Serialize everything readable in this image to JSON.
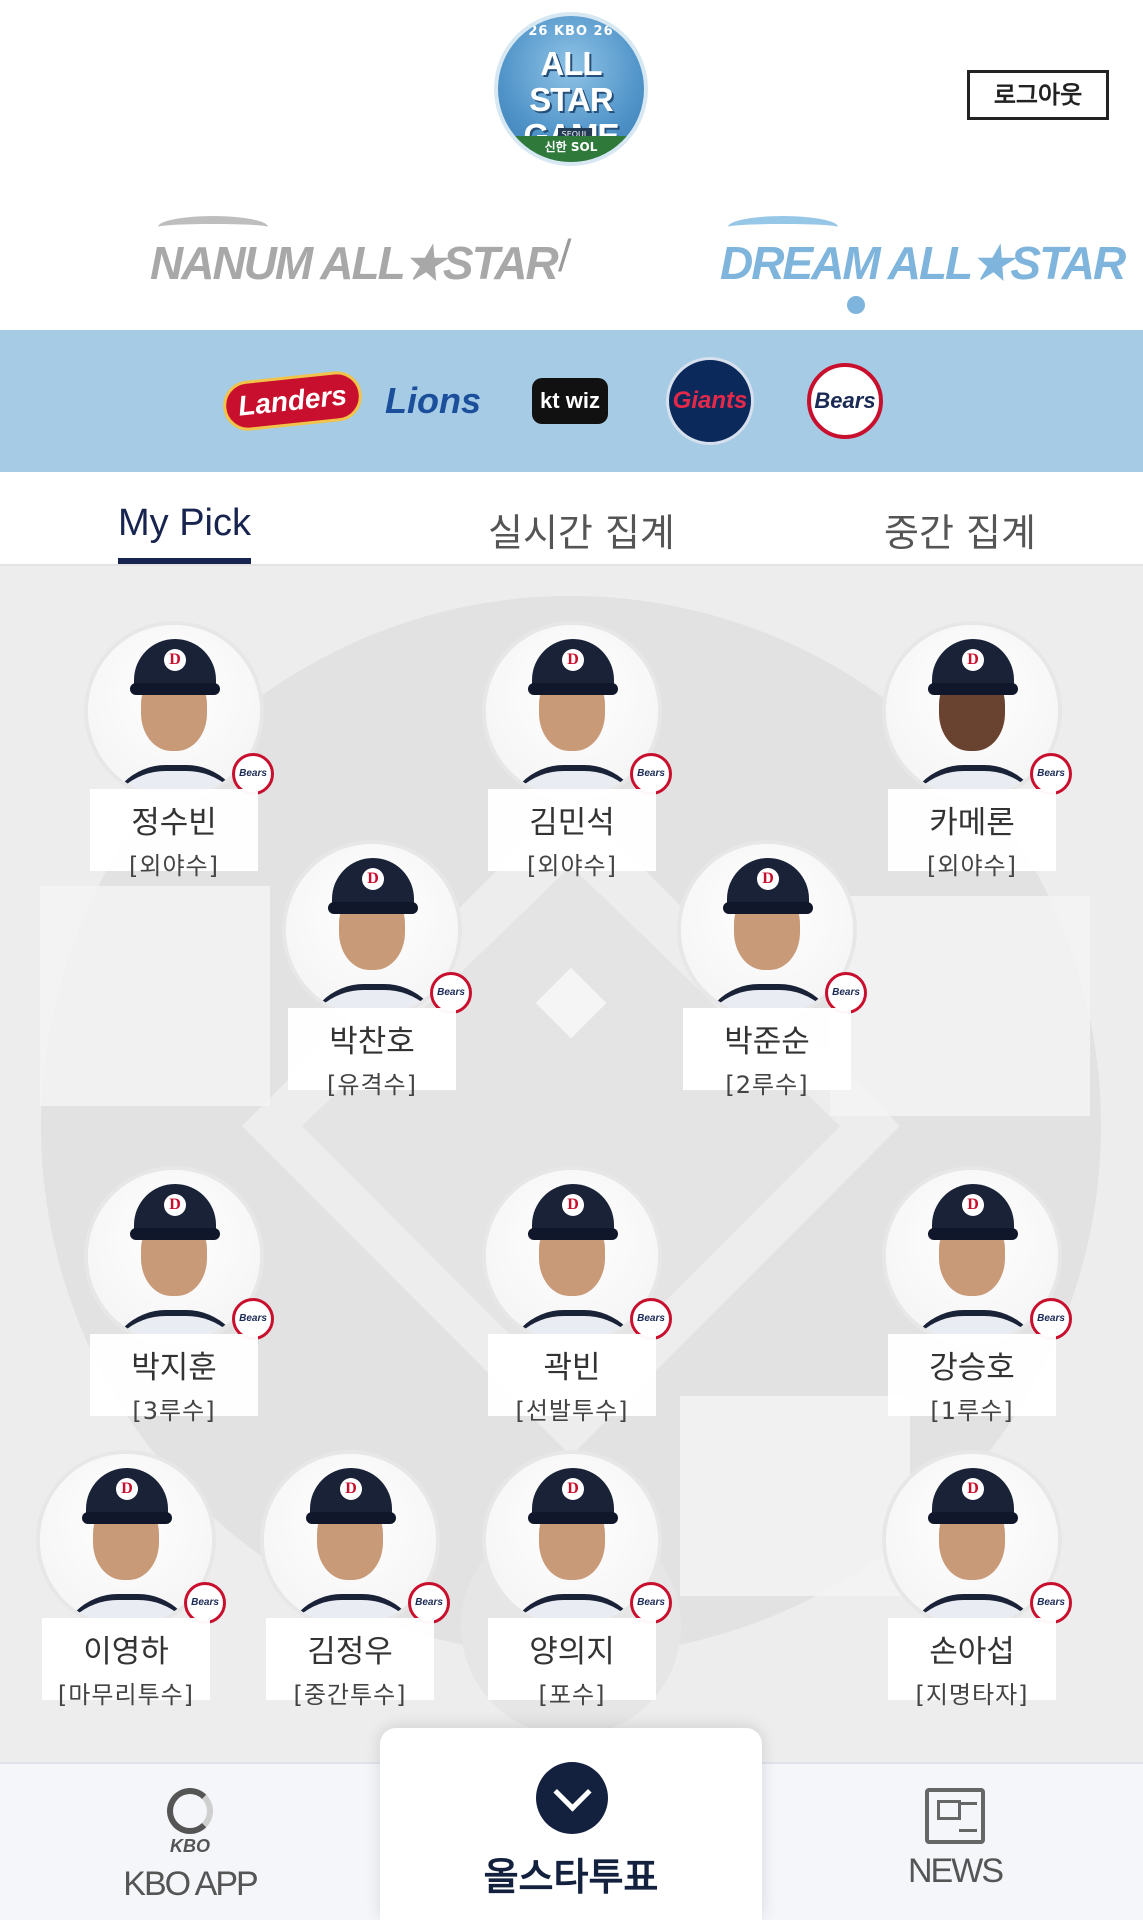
{
  "header": {
    "event_logo": {
      "ring_text": "26 KBO 26",
      "title_line1": "ALL STAR",
      "title_line2": "GAME",
      "city": "SEOUL",
      "sponsor": "신한 SOL"
    },
    "logout_label": "로그아웃"
  },
  "leagues": {
    "nanum": "NANUM ALL★STAR",
    "separator": "/",
    "dream": "DREAM ALL★STAR",
    "active": "dream",
    "active_color": "#7fb5dc",
    "inactive_color": "#a8a8a8"
  },
  "teams": [
    {
      "id": "landers",
      "label": "Landers",
      "icon": "ssg-landers-logo"
    },
    {
      "id": "lions",
      "label": "Lions",
      "icon": "samsung-lions-logo"
    },
    {
      "id": "ktwiz",
      "label": "kt wiz",
      "icon": "kt-wiz-logo"
    },
    {
      "id": "giants",
      "label": "Giants",
      "icon": "lotte-giants-logo"
    },
    {
      "id": "bears",
      "label": "Bears",
      "icon": "doosan-bears-logo"
    }
  ],
  "tabs": [
    "My Pick",
    "실시간 집계",
    "중간 집계"
  ],
  "active_tab": "My Pick",
  "players": [
    {
      "name": "정수빈",
      "position": "[외야수]",
      "team_badge": "Bears"
    },
    {
      "name": "김민석",
      "position": "[외야수]",
      "team_badge": "Bears"
    },
    {
      "name": "카메론",
      "position": "[외야수]",
      "team_badge": "Bears"
    },
    {
      "name": "박찬호",
      "position": "[유격수]",
      "team_badge": "Bears"
    },
    {
      "name": "박준순",
      "position": "[2루수]",
      "team_badge": "Bears"
    },
    {
      "name": "박지훈",
      "position": "[3루수]",
      "team_badge": "Bears"
    },
    {
      "name": "곽빈",
      "position": "[선발투수]",
      "team_badge": "Bears"
    },
    {
      "name": "강승호",
      "position": "[1루수]",
      "team_badge": "Bears"
    },
    {
      "name": "이영하",
      "position": "[마무리투수]",
      "team_badge": "Bears"
    },
    {
      "name": "김정우",
      "position": "[중간투수]",
      "team_badge": "Bears"
    },
    {
      "name": "양의지",
      "position": "[포수]",
      "team_badge": "Bears"
    },
    {
      "name": "손아섭",
      "position": "[지명타자]",
      "team_badge": "Bears"
    }
  ],
  "bottom_nav": {
    "kbo_app": {
      "icon": "kbo-logo-icon",
      "mini": "KBO",
      "label": "KBO APP"
    },
    "vote": {
      "icon": "chevron-down-icon",
      "label": "올스타투표"
    },
    "news": {
      "icon": "newspaper-icon",
      "label": "NEWS"
    }
  },
  "colors": {
    "brand_navy": "#13213f",
    "team_band": "#a6cbe4",
    "field_bg": "#ededed"
  }
}
